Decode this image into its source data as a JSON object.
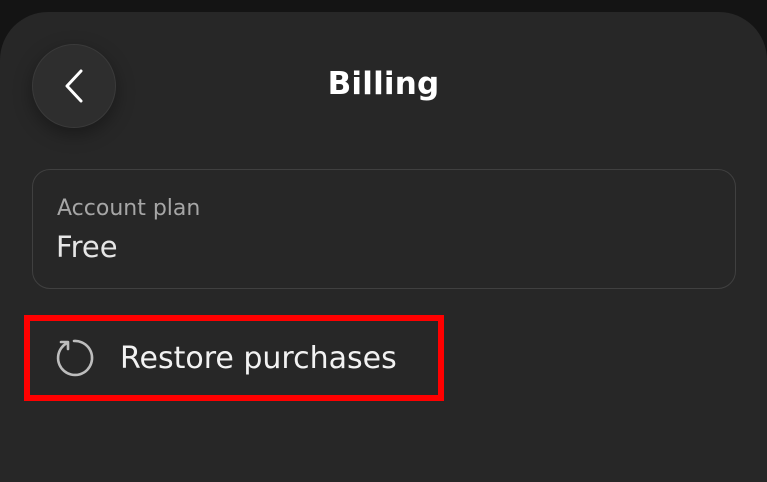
{
  "header": {
    "title": "Billing",
    "back_icon": "chevron-left-icon"
  },
  "account_plan": {
    "label": "Account plan",
    "value": "Free"
  },
  "restore": {
    "icon": "refresh-icon",
    "label": "Restore purchases"
  },
  "colors": {
    "background": "#272727",
    "text": "#ffffff",
    "muted_text": "#a6a6a6",
    "highlight": "#ff0000"
  }
}
